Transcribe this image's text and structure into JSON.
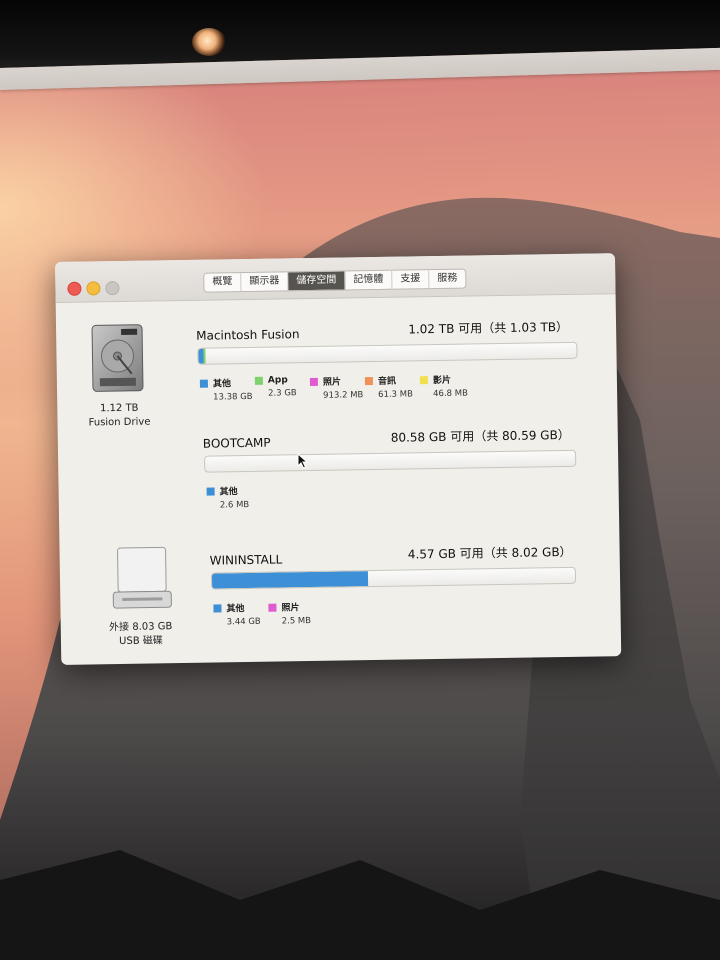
{
  "colors": {
    "other": "#3d8fd6",
    "app": "#7fd16e",
    "photos": "#e05ad0",
    "audio": "#f0915a",
    "movies": "#f1e04e"
  },
  "tabs": [
    "概覽",
    "顯示器",
    "儲存空間",
    "記憶體",
    "支援",
    "服務"
  ],
  "active_tab": "儲存空間",
  "drives": [
    {
      "icon": "hard-drive-icon",
      "size": "1.12 TB",
      "type": "Fusion Drive"
    },
    {
      "icon": "external-usb-drive-icon",
      "size": "外接 8.03 GB",
      "type": "USB 磁碟"
    }
  ],
  "volumes": [
    {
      "name": "Macintosh Fusion",
      "free": "1.02 TB 可用（共 1.03 TB）",
      "usage": [
        {
          "key": "other",
          "fraction": 0.013
        },
        {
          "key": "photos",
          "fraction": 0.001
        },
        {
          "key": "app",
          "fraction": 0.002
        }
      ],
      "legend": [
        {
          "key": "other",
          "label": "其他",
          "size": "13.38 GB"
        },
        {
          "key": "app",
          "label": "App",
          "size": "2.3 GB"
        },
        {
          "key": "photos",
          "label": "照片",
          "size": "913.2 MB"
        },
        {
          "key": "audio",
          "label": "音訊",
          "size": "61.3 MB"
        },
        {
          "key": "movies",
          "label": "影片",
          "size": "46.8 MB"
        }
      ]
    },
    {
      "name": "BOOTCAMP",
      "free": "80.58 GB 可用（共 80.59 GB）",
      "usage": [],
      "legend": [
        {
          "key": "other",
          "label": "其他",
          "size": "2.6 MB"
        }
      ]
    },
    {
      "name": "WININSTALL",
      "free": "4.57 GB 可用（共 8.02 GB）",
      "usage": [
        {
          "key": "other",
          "fraction": 0.43
        }
      ],
      "legend": [
        {
          "key": "other",
          "label": "其他",
          "size": "3.44 GB"
        },
        {
          "key": "photos",
          "label": "照片",
          "size": "2.5 MB"
        }
      ]
    }
  ]
}
